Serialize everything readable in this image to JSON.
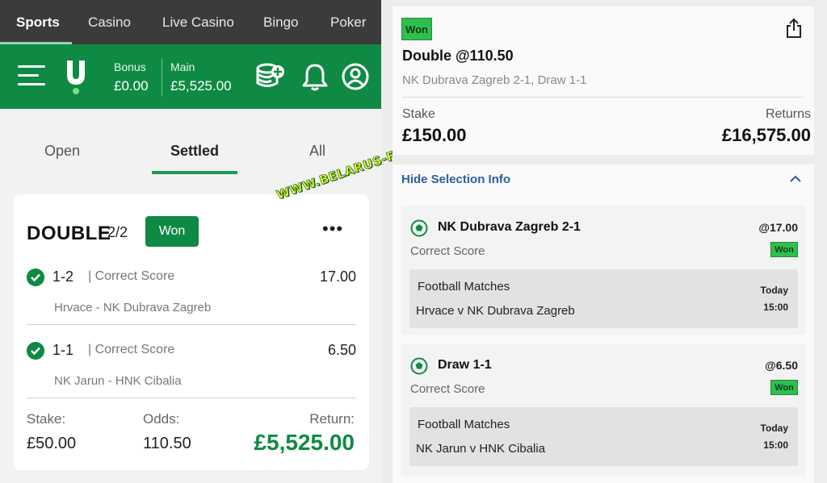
{
  "top_nav": {
    "tabs": [
      {
        "label": "Sports",
        "active": true
      },
      {
        "label": "Casino",
        "active": false
      },
      {
        "label": "Live Casino",
        "active": false
      },
      {
        "label": "Bingo",
        "active": false
      },
      {
        "label": "Poker",
        "active": false
      }
    ]
  },
  "header": {
    "bonus_label": "Bonus",
    "bonus_value": "£0.00",
    "main_label": "Main",
    "main_value": "£5,525.00",
    "icons": [
      "menu-icon",
      "logo",
      "deposit-coins-icon",
      "bell-icon",
      "account-icon"
    ],
    "brand_color": "#0f8a44"
  },
  "bet_tabs": [
    {
      "label": "Open",
      "active": false
    },
    {
      "label": "Settled",
      "active": true
    },
    {
      "label": "All",
      "active": false
    }
  ],
  "bet_card": {
    "type": "DOUBLE",
    "count": "2/2",
    "status": "Won",
    "more": "•••",
    "selections": [
      {
        "score": "1-2",
        "market": "| Correct Score",
        "odds": "17.00",
        "match": "Hrvace - NK Dubrava Zagreb"
      },
      {
        "score": "1-1",
        "market": "| Correct Score",
        "odds": "6.50",
        "match": "NK Jarun - HNK Cibalia"
      }
    ],
    "stake_label": "Stake:",
    "stake_value": "£50.00",
    "odds_label": "Odds:",
    "odds_value": "110.50",
    "return_label": "Return:",
    "return_value": "£5,525.00"
  },
  "watermark": "WWW.BELARUS-FIXED.COM",
  "detail": {
    "status": "Won",
    "title": "Double @110.50",
    "subtitle": "NK Dubrava Zagreb 2-1, Draw 1-1",
    "stake_label": "Stake",
    "stake_value": "£150.00",
    "returns_label": "Returns",
    "returns_value": "£16,575.00",
    "hide_label": "Hide Selection Info",
    "selections": [
      {
        "name": "NK Dubrava Zagreb 2-1",
        "odds": "@17.00",
        "market": "Correct Score",
        "status": "Won",
        "category": "Football Matches",
        "event": "Hrvace v NK Dubrava Zagreb",
        "day": "Today",
        "time": "15:00"
      },
      {
        "name": "Draw 1-1",
        "odds": "@6.50",
        "market": "Correct Score",
        "status": "Won",
        "category": "Football Matches",
        "event": "NK Jarun v HNK Cibalia",
        "day": "Today",
        "time": "15:00"
      }
    ]
  }
}
